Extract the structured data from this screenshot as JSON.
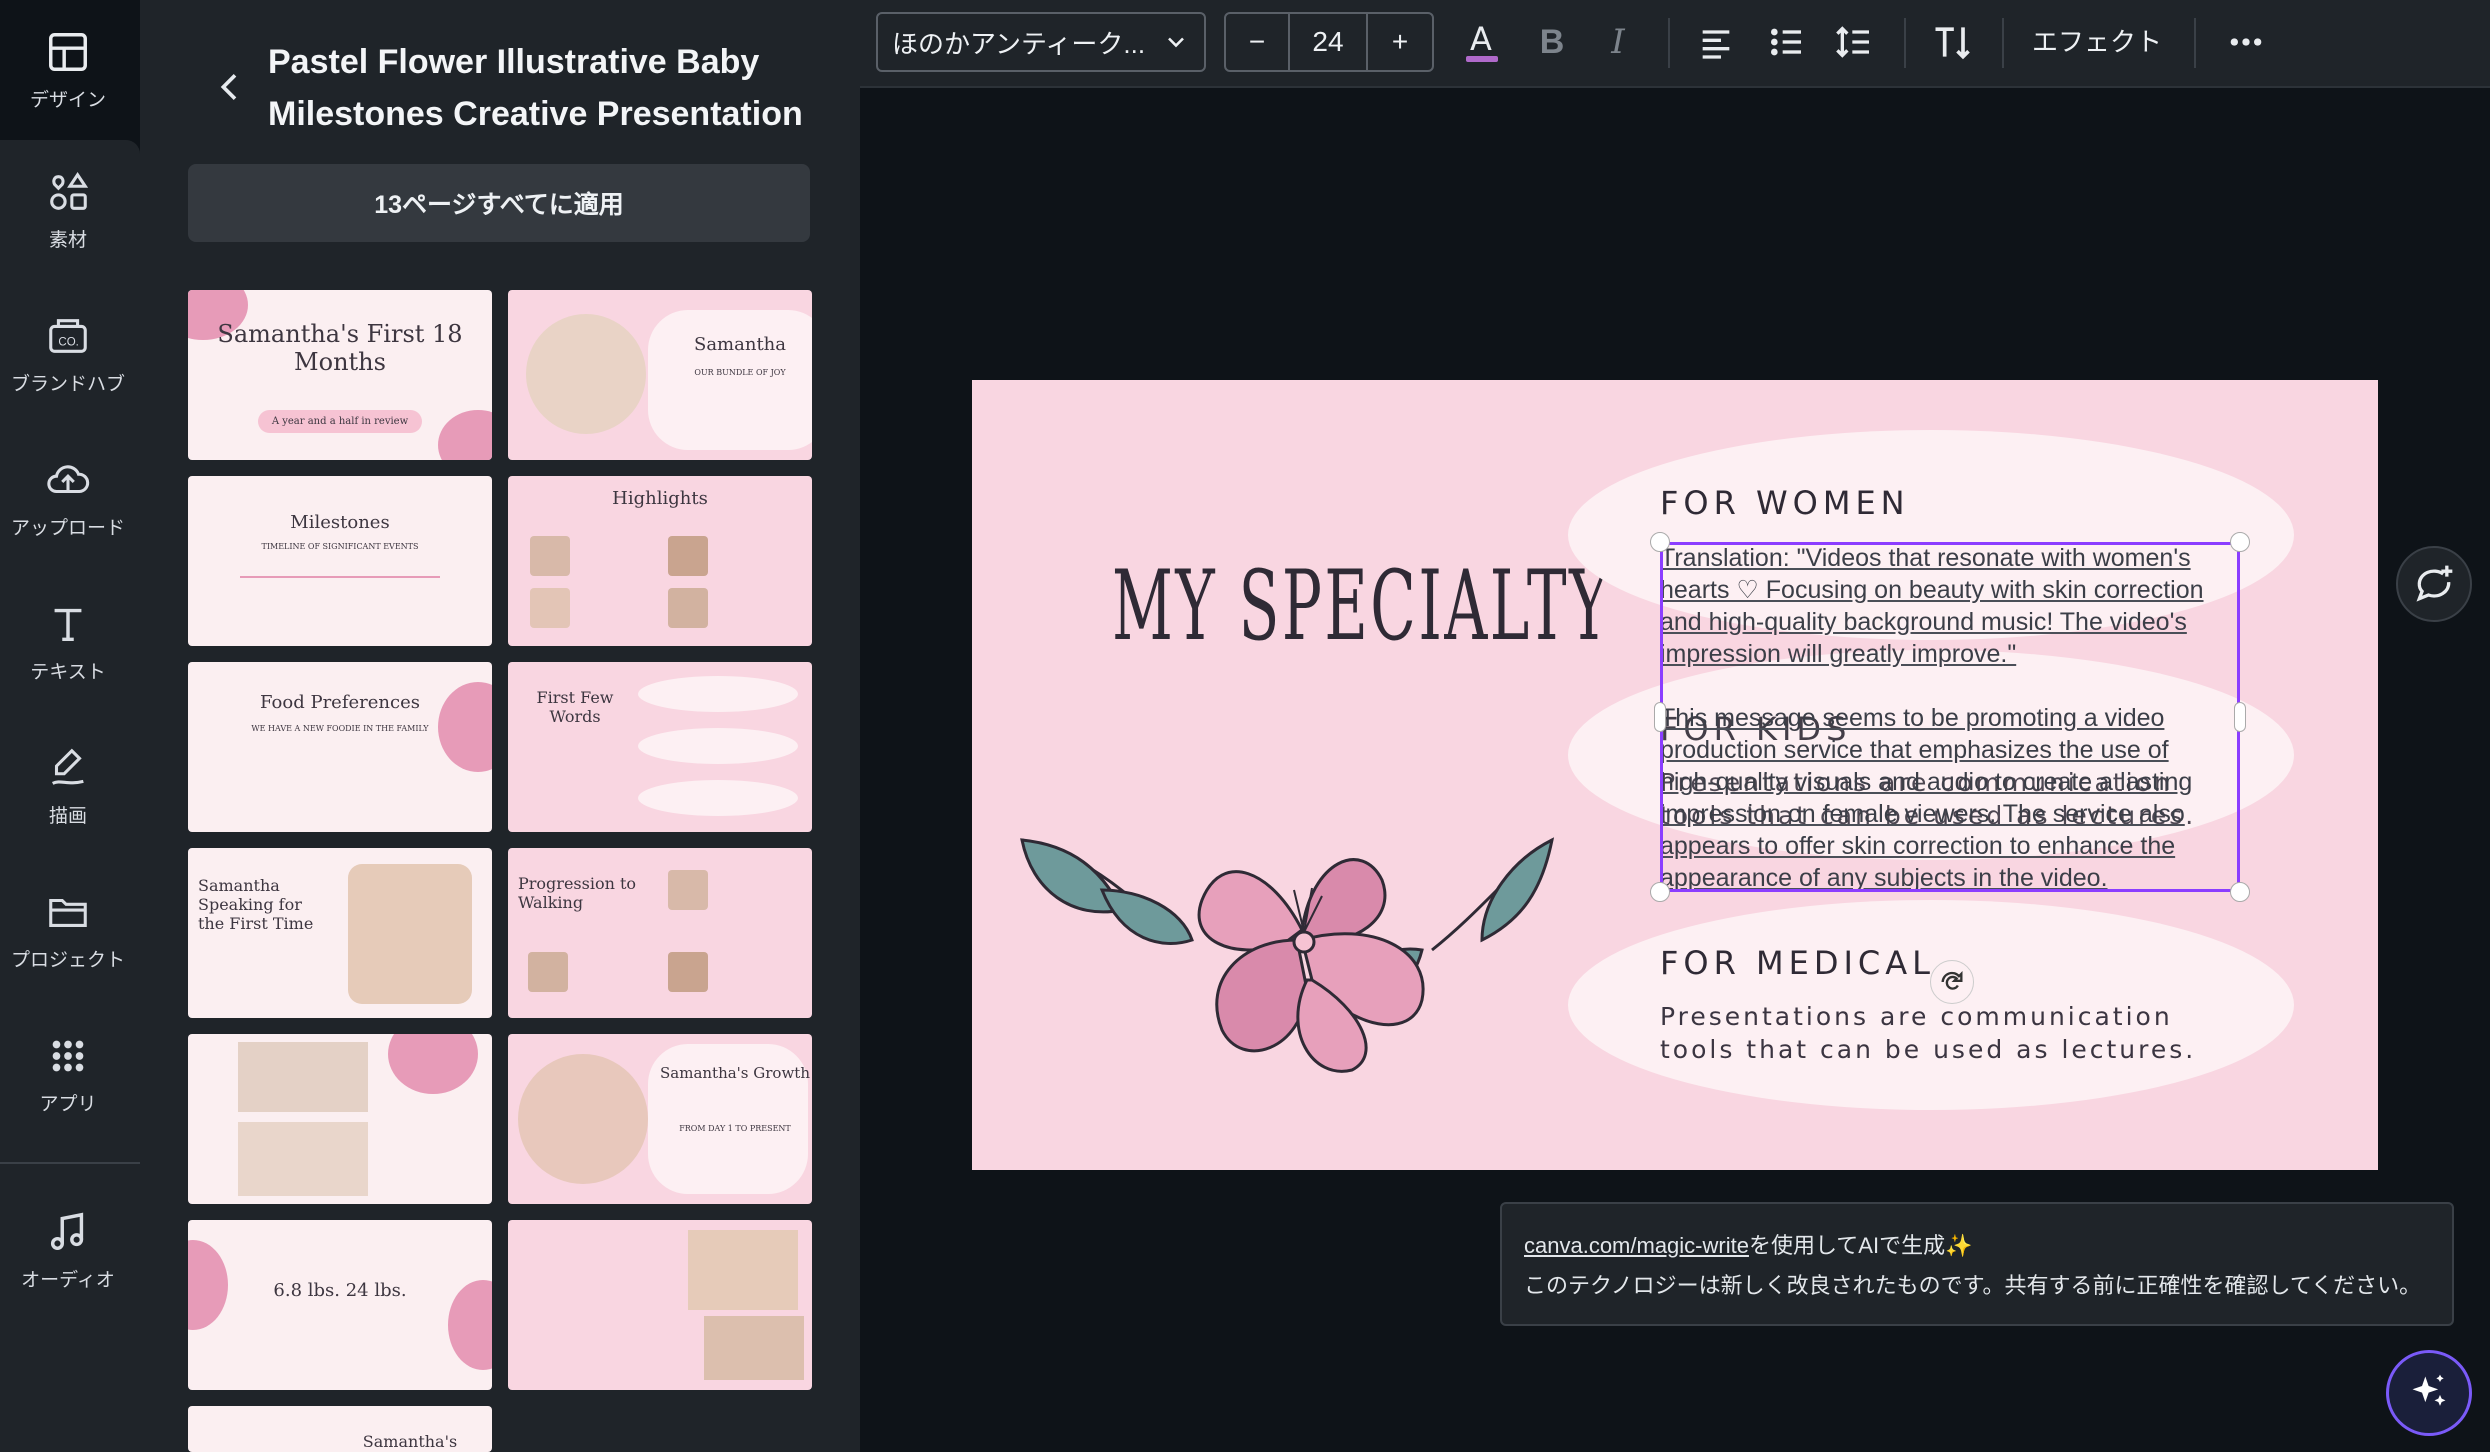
{
  "rail": {
    "items": [
      {
        "label": "デザイン",
        "icon": "layout-icon"
      },
      {
        "label": "素材",
        "icon": "elements-icon"
      },
      {
        "label": "ブランドハブ",
        "icon": "brand-icon"
      },
      {
        "label": "アップロード",
        "icon": "cloud-upload-icon"
      },
      {
        "label": "テキスト",
        "icon": "text-icon"
      },
      {
        "label": "描画",
        "icon": "draw-icon"
      },
      {
        "label": "プロジェクト",
        "icon": "folder-icon"
      },
      {
        "label": "アプリ",
        "icon": "apps-icon"
      },
      {
        "label": "オーディオ",
        "icon": "music-icon"
      }
    ]
  },
  "panel": {
    "title": "Pastel Flower Illustrative Baby Milestones Creative Presentation",
    "apply_all": "13ページすべてに適用",
    "thumbnails": [
      {
        "title": "Samantha's First 18 Months",
        "sub": "A year and a half in review"
      },
      {
        "title": "Samantha",
        "sub": "OUR BUNDLE OF JOY"
      },
      {
        "title": "Milestones",
        "sub": "TIMELINE OF SIGNIFICANT EVENTS"
      },
      {
        "title": "Highlights",
        "sub": ""
      },
      {
        "title": "Food Preferences",
        "sub": "WE HAVE A NEW FOODIE IN THE FAMILY"
      },
      {
        "title": "First Few Words",
        "sub": ""
      },
      {
        "title": "Samantha Speaking for the First Time",
        "sub": ""
      },
      {
        "title": "Progression to Walking",
        "sub": ""
      },
      {
        "title": "",
        "sub": ""
      },
      {
        "title": "Samantha's Growth",
        "sub": "FROM DAY 1 TO PRESENT"
      },
      {
        "title": "6.8 lbs.   24 lbs.",
        "sub": ""
      },
      {
        "title": "",
        "sub": ""
      },
      {
        "title": "Samantha's",
        "sub": ""
      }
    ]
  },
  "toolbar": {
    "font_name": "ほのかアンティーク...",
    "font_size": "24",
    "minus": "−",
    "plus": "+",
    "effects": "エフェクト"
  },
  "slide": {
    "title": "MY SPECIALTY",
    "sections": [
      {
        "heading": "FOR WOMEN",
        "body": ""
      },
      {
        "heading": "FOR KIDS",
        "body": "Presentations are communication tools that can be used as lectures."
      },
      {
        "heading": "FOR MEDICAL",
        "body": "Presentations are communication tools that can be used as lectures."
      }
    ],
    "overlay_text": "Translation: \"Videos that resonate with women's hearts ♡ Focusing on beauty with skin correction and high-quality background music! The video's impression will greatly improve.\"\n\nThis message seems to be promoting a video production service that emphasizes the use of high-quality visuals and audio to create a lasting impression on female viewers. The service also appears to offer skin correction to enhance the appearance of any subjects in the video."
  },
  "notice": {
    "link": "canva.com/magic-write",
    "link_suffix": "を使用してAIで生成✨",
    "disclaimer": "このテクノロジーは新しく改良されたものです。共有する前に正確性を確認してください。"
  },
  "colors": {
    "accent": "#8b3dff",
    "slide_bg": "#f9d6e1",
    "pill": "#fdf0f3"
  }
}
